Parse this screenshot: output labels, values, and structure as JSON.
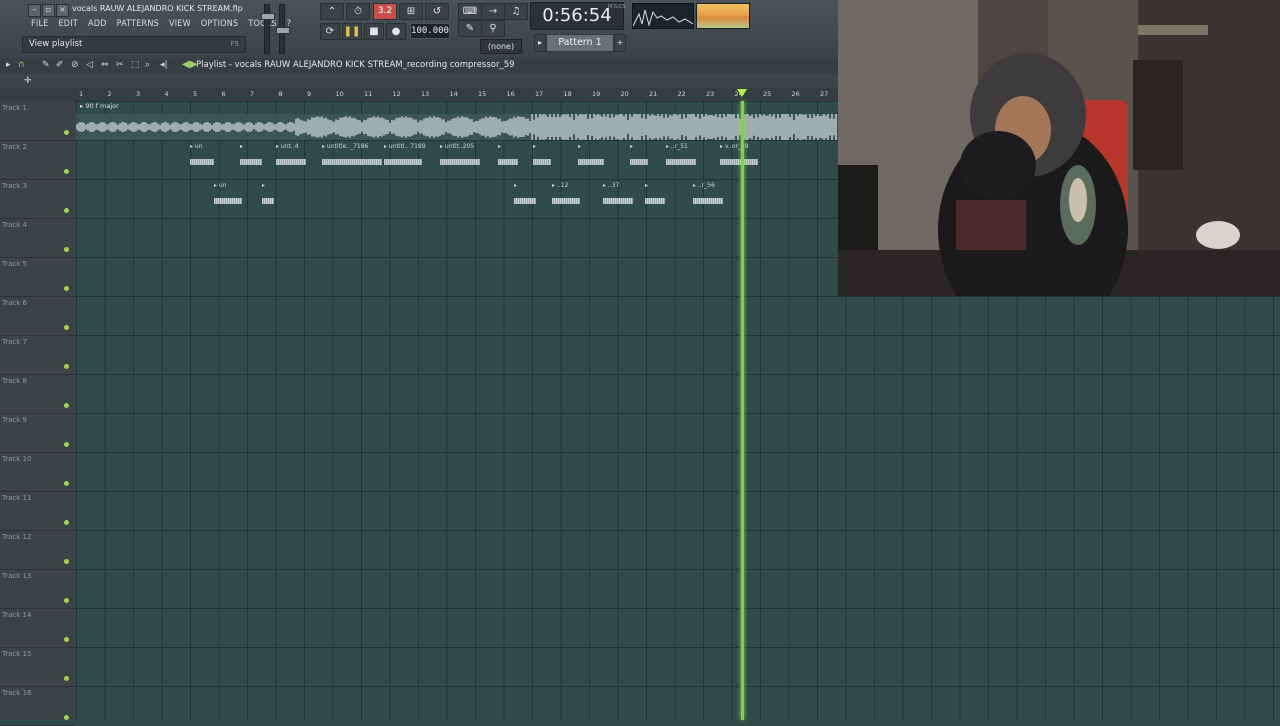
{
  "window": {
    "title": "vocals RAUW ALEJANDRO KICK STREAM.flp",
    "menu": [
      "FILE",
      "EDIT",
      "ADD",
      "PATTERNS",
      "VIEW",
      "OPTIONS",
      "TOOLS",
      "?"
    ],
    "hint": "View playlist",
    "hint_key": "F5"
  },
  "transport": {
    "tempo": "100.000",
    "time": "0:56:54",
    "time_unit": "M:S:CS",
    "snap_label": "3.2",
    "none_select": "(none)",
    "pattern": "Pattern 1"
  },
  "playlist": {
    "title": "Playlist - vocals RAUW ALEJANDRO KICK STREAM_recording compressor_59",
    "marker": "90 f major",
    "ruler_numbers": [
      "1",
      "2",
      "3",
      "4",
      "5",
      "6",
      "7",
      "8",
      "9",
      "10",
      "11",
      "12",
      "13",
      "14",
      "15",
      "16",
      "17",
      "18",
      "19",
      "20",
      "21",
      "22",
      "23",
      "24",
      "25",
      "26",
      "27"
    ],
    "tracks": [
      "Track 1",
      "Track 2",
      "Track 3",
      "Track 4",
      "Track 5",
      "Track 6",
      "Track 7",
      "Track 8",
      "Track 9",
      "Track 10",
      "Track 11",
      "Track 12",
      "Track 13",
      "Track 14",
      "Track 15",
      "Track 16"
    ],
    "track2_clips": [
      "un",
      "",
      "unt..4",
      "untitle.._7186",
      "untitl.. 7189",
      "untit..205",
      "",
      "",
      "",
      "",
      "..r_51",
      "v..or_59"
    ],
    "track3_clips": [
      "un",
      "",
      "",
      "..12",
      "..37",
      "",
      "..r_56"
    ]
  },
  "colors": {
    "playhead": "#7bd34a",
    "grid": "#2f4b4b",
    "accent_red": "#c9504a"
  }
}
